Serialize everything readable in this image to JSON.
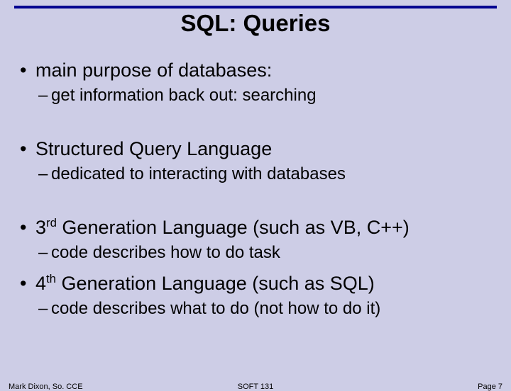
{
  "title": "SQL: Queries",
  "bullets": [
    {
      "text": "main purpose of databases:",
      "gap": "first",
      "sub": [
        {
          "text": "get information back out: searching"
        }
      ]
    },
    {
      "text": "Structured Query Language",
      "gap": "lg",
      "sub": [
        {
          "text": "dedicated to interacting with databases"
        }
      ]
    },
    {
      "prefix": "3",
      "sup": "rd",
      "rest": " Generation Language (such as VB, C++)",
      "gap": "lg",
      "sub": [
        {
          "text": "code describes how to do task"
        }
      ]
    },
    {
      "prefix": "4",
      "sup": "th",
      "rest": " Generation Language (such as SQL)",
      "gap": "sm",
      "sub": [
        {
          "text": "code describes what to do (not how to do it)"
        }
      ]
    }
  ],
  "footer": {
    "left": "Mark Dixon, So. CCE",
    "center": "SOFT 131",
    "right": "Page 7"
  }
}
